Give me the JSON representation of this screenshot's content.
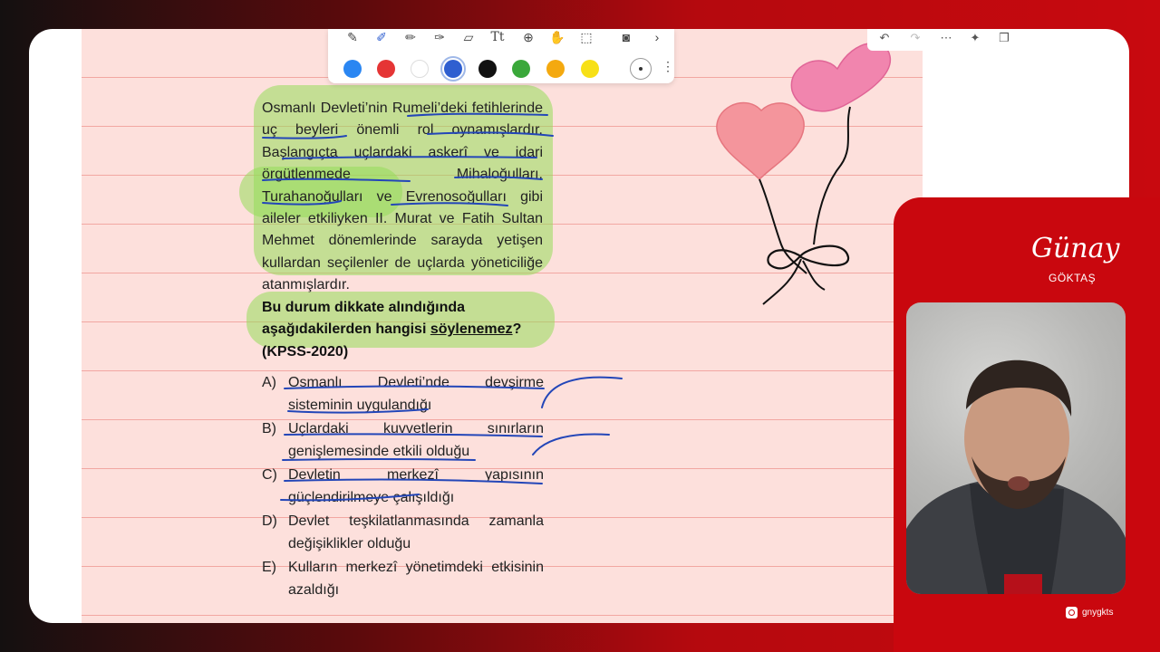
{
  "toolbar": {
    "tools": [
      "pencil-icon",
      "pen-icon",
      "marker-icon",
      "lasso-pen-icon",
      "eraser-icon",
      "text-icon",
      "add-icon",
      "hand-icon",
      "select-icon",
      "camera-icon",
      "chevron-right-icon"
    ],
    "colors": [
      "#2a86f2",
      "#e53535",
      "#ffffff",
      "#2f5fd0",
      "#111111",
      "#3aa83a",
      "#f4a90f",
      "#f7e017"
    ],
    "selected_color": "#2f5fd0",
    "more_label": "⋮"
  },
  "topbar": {
    "icons": [
      "undo-icon",
      "redo-icon",
      "more-icon",
      "magic-icon",
      "pages-icon"
    ]
  },
  "question": {
    "paragraph": "Osmanlı Devleti’nin Rumeli’deki fetihlerinde uç beyleri önemli rol oynamışlardır. Başlangıçta uçlardaki askerî ve idari örgütlenmede Mihaloğulları, Turahanoğulları ve Evrenosoğulları gibi aileler etkiliyken II. Murat ve Fatih Sultan Mehmet dönemlerinde sarayda yetişen kullardan seçilenler de uçlarda yöneticiliğe atanmışlardır.",
    "prompt_start": "Bu durum dikkate alındığında aşağıdakilerden hangisi ",
    "prompt_emph": "söylenemez",
    "prompt_end": "?",
    "source": "(KPSS-2020)",
    "options": [
      {
        "letter": "A)",
        "text": "Osmanlı Devleti’nde devşirme sisteminin uygulandığı"
      },
      {
        "letter": "B)",
        "text": "Uçlardaki kuvvetlerin sınırların genişlemesinde etkili olduğu"
      },
      {
        "letter": "C)",
        "text": "Devletin merkezî yapısının güçlendirilmeye çalışıldığı"
      },
      {
        "letter": "D)",
        "text": "Devlet teşkilatlanmasında zamanla değişiklikler olduğu"
      },
      {
        "letter": "E)",
        "text": "Kulların merkezî yönetimdeki etkisinin azaldığı"
      }
    ]
  },
  "brand": {
    "name": "Günay",
    "surname": "GÖKTAŞ"
  },
  "social": {
    "handle": "gnygkts"
  }
}
